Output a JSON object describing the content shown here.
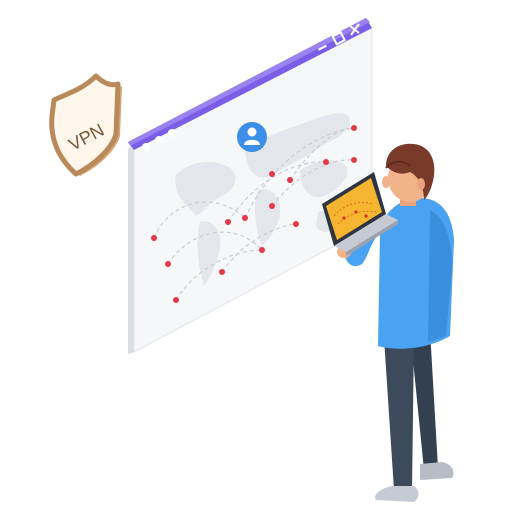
{
  "shield": {
    "label": "VPN",
    "icon": "vpn-shield-icon"
  },
  "browser_window": {
    "controls": [
      "minimize-icon",
      "maximize-icon",
      "close-icon"
    ],
    "dots": [
      "dot-icon",
      "dot-icon",
      "dot-icon"
    ],
    "center_icon": "user-icon",
    "map_icon": "world-map-icon"
  },
  "person": {
    "device": "laptop-icon"
  },
  "colors": {
    "titlebar": "#7b5ee8",
    "shield_border": "#b88a5a",
    "shield_fill": "#fff6ec",
    "pin": "#e23a4a",
    "shirt": "#4aa3f2",
    "pants": "#3d4a5c",
    "hair": "#7a3a2a",
    "skin": "#f2b28a",
    "map": "#e6e8ec"
  }
}
